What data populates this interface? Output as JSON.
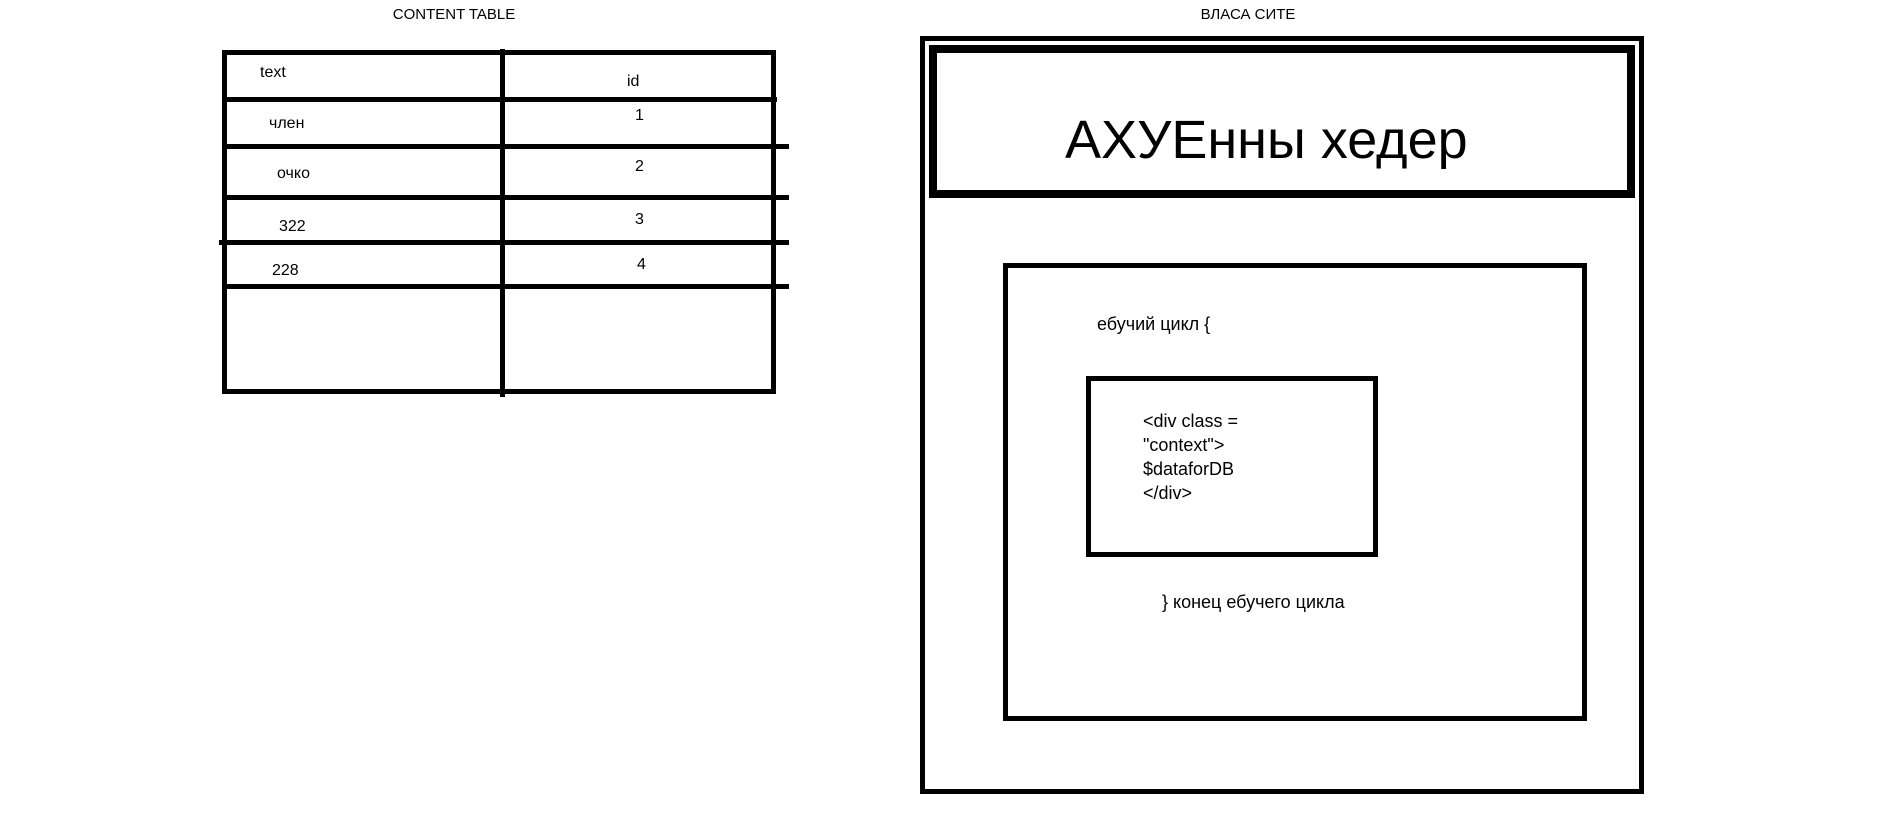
{
  "content_table": {
    "title": "CONTENT TABLE",
    "headers": [
      "text",
      "id"
    ],
    "rows": [
      {
        "text": "член",
        "id": "1"
      },
      {
        "text": "очко",
        "id": "2"
      },
      {
        "text": "322",
        "id": "3"
      },
      {
        "text": "228",
        "id": "4"
      }
    ]
  },
  "site": {
    "title": "ВЛАСА СИТЕ",
    "header_text": "АХУЕнны хедер",
    "loop_start": "ебучий цикл {",
    "code_lines": [
      "<div class =",
      "\"context\">",
      "$dataforDB",
      "</div>"
    ],
    "loop_end": "} конец ебучего цикла"
  }
}
